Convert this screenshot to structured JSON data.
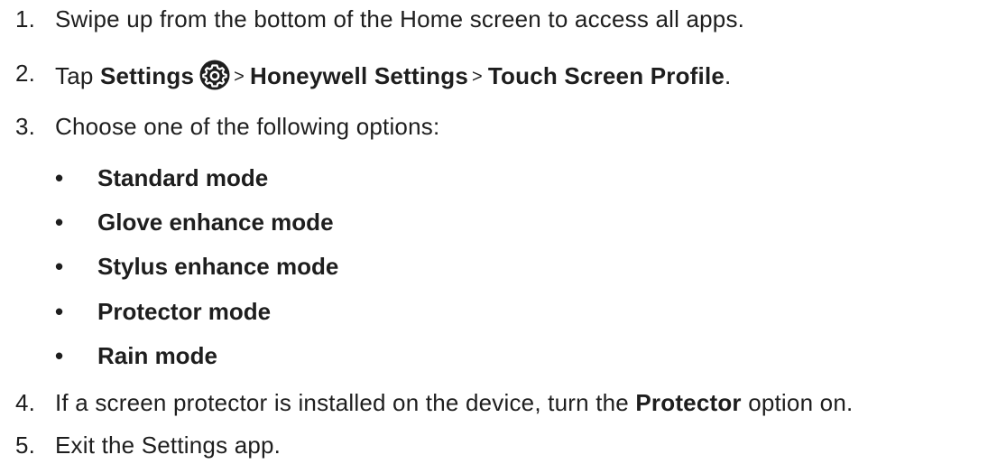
{
  "steps": [
    {
      "number": "1.",
      "text": "Swipe up from the bottom of the Home screen to access all apps."
    },
    {
      "number": "2.",
      "prefix": "Tap ",
      "settings": "Settings",
      "settings_icon": "gear-icon",
      "separator": ">",
      "honeywell_settings": "Honeywell Settings",
      "touch_screen_profile": "Touch Screen Profile",
      "suffix": "."
    },
    {
      "number": "3.",
      "text": "Choose one of the following options:",
      "options": [
        "Standard mode",
        "Glove enhance mode",
        "Stylus enhance mode",
        "Protector mode",
        "Rain mode"
      ],
      "bullet": "•"
    },
    {
      "number": "4.",
      "before": "If a screen protector is installed on the device, turn the ",
      "bold": "Protector",
      "after": " option on."
    },
    {
      "number": "5.",
      "text": "Exit the Settings app."
    }
  ],
  "colors": {
    "text": "#1e1e1e",
    "icon": "#1e1e1e"
  }
}
